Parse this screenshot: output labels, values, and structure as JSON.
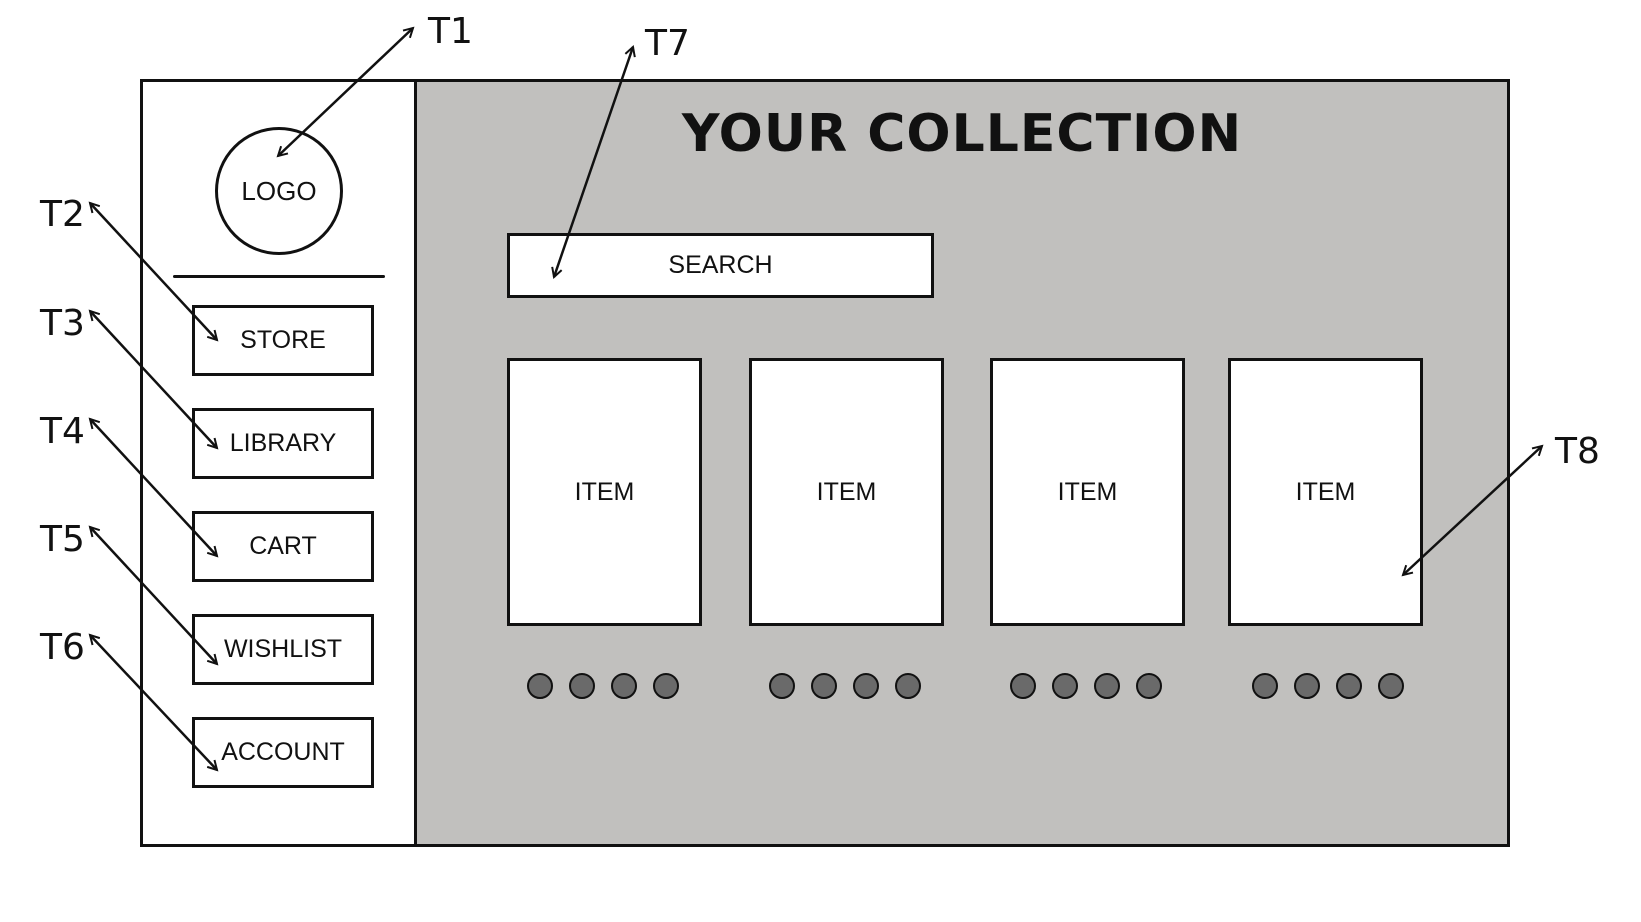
{
  "sidebar": {
    "logo": "LOGO",
    "nav": [
      "STORE",
      "LIBRARY",
      "CART",
      "WISHLIST",
      "ACCOUNT"
    ]
  },
  "main": {
    "title": "YOUR COLLECTION",
    "search": "SEARCH",
    "items": [
      "ITEM",
      "ITEM",
      "ITEM",
      "ITEM"
    ]
  },
  "annotations": [
    "T1",
    "T2",
    "T3",
    "T4",
    "T5",
    "T6",
    "T7",
    "T8"
  ]
}
